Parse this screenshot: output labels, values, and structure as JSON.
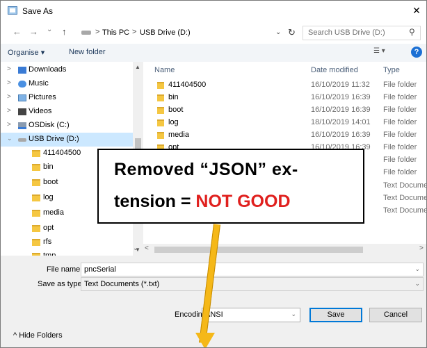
{
  "window": {
    "title": "Save As",
    "close_glyph": "✕"
  },
  "address": {
    "breadcrumbs": [
      "This PC",
      "USB Drive (D:)"
    ],
    "separator": ">",
    "search_placeholder": "Search USB Drive (D:)"
  },
  "nav_buttons": {
    "back": "←",
    "forward": "→",
    "recent": "⌄",
    "up": "↑"
  },
  "toolbar": {
    "organise": "Organise ▾",
    "new_folder": "New folder",
    "help": "?"
  },
  "nav": {
    "items": [
      {
        "label": "Downloads",
        "icon": "downloads-icon"
      },
      {
        "label": "Music",
        "icon": "music-icon"
      },
      {
        "label": "Pictures",
        "icon": "pictures-icon"
      },
      {
        "label": "Videos",
        "icon": "videos-icon"
      },
      {
        "label": "OSDisk (C:)",
        "icon": "disk-icon"
      },
      {
        "label": "USB Drive (D:)",
        "icon": "usb-drive-icon",
        "selected": true
      },
      {
        "label": "411404500",
        "icon": "folder-icon"
      },
      {
        "label": "bin",
        "icon": "folder-icon"
      },
      {
        "label": "boot",
        "icon": "folder-icon"
      },
      {
        "label": "log",
        "icon": "folder-icon"
      },
      {
        "label": "media",
        "icon": "folder-icon"
      },
      {
        "label": "opt",
        "icon": "folder-icon"
      },
      {
        "label": "rfs",
        "icon": "folder-icon"
      },
      {
        "label": "tmp",
        "icon": "folder-icon"
      }
    ]
  },
  "files": {
    "columns": {
      "name": "Name",
      "date": "Date modified",
      "type": "Type"
    },
    "rows": [
      {
        "name": "411404500",
        "date": "16/10/2019 11:32",
        "type": "File folder"
      },
      {
        "name": "bin",
        "date": "16/10/2019 16:39",
        "type": "File folder"
      },
      {
        "name": "boot",
        "date": "16/10/2019 16:39",
        "type": "File folder"
      },
      {
        "name": "log",
        "date": "18/10/2019 14:01",
        "type": "File folder"
      },
      {
        "name": "media",
        "date": "16/10/2019 16:39",
        "type": "File folder"
      },
      {
        "name": "opt",
        "date": "16/10/2019 16:39",
        "type": "File folder"
      },
      {
        "name": "",
        "date": "",
        "type": "File folder"
      },
      {
        "name": "",
        "date": "",
        "type": "File folder"
      },
      {
        "name": "",
        "date": "",
        "type": "Text Documen"
      },
      {
        "name": "",
        "date": "",
        "type": "Text Documen"
      },
      {
        "name": "",
        "date": "",
        "type": "Text Documen"
      }
    ]
  },
  "form": {
    "file_name_label": "File name:",
    "file_name_value": "pncSerial",
    "save_type_label": "Save as type:",
    "save_type_value": "Text Documents (*.txt)",
    "hide_folders": "^ Hide Folders",
    "encoding_label": "Encoding:",
    "encoding_value": "ANSI",
    "save_button": "Save",
    "cancel_button": "Cancel"
  },
  "annotation": {
    "line1": "Removed “JSON” ex-",
    "line2_prefix": "tension = ",
    "line2_highlight": "NOT GOOD",
    "highlight_color": "#e0201e",
    "arrow_color": "#f5b818"
  }
}
